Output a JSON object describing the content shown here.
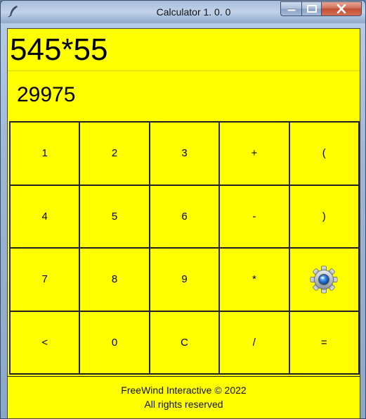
{
  "window": {
    "title": "Calculator 1. 0. 0",
    "controls": {
      "minimize": "minimize",
      "maximize": "maximize",
      "close": "close"
    }
  },
  "display": {
    "expression": "545*55",
    "result": "29975"
  },
  "keypad": {
    "rows": [
      [
        "1",
        "2",
        "3",
        "+",
        "("
      ],
      [
        "4",
        "5",
        "6",
        "-",
        ")"
      ],
      [
        "7",
        "8",
        "9",
        "*",
        "settings"
      ],
      [
        "<",
        "0",
        "C",
        "/",
        "="
      ]
    ]
  },
  "footer": {
    "line1": "FreeWind Interactive © 2022",
    "line2": "All rights reserved"
  },
  "colors": {
    "background": "#ffff00",
    "border": "#222222",
    "text": "#000000"
  }
}
